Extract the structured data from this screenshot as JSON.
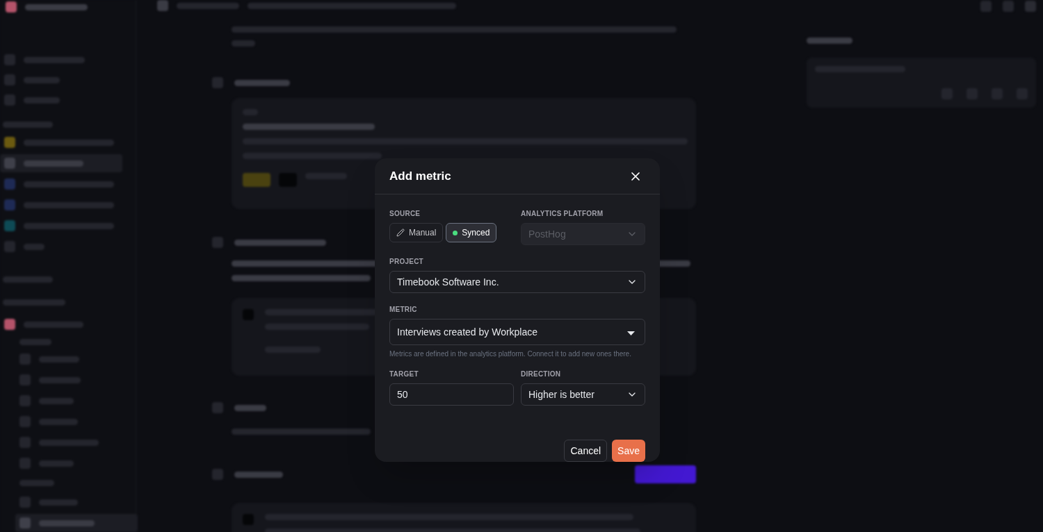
{
  "modal": {
    "title": "Add metric",
    "source_label": "SOURCE",
    "sources": [
      {
        "label": "Manual",
        "kind": "pencil",
        "selected": false
      },
      {
        "label": "Synced",
        "kind": "dot",
        "selected": true
      }
    ],
    "platform_label": "ANALYTICS PLATFORM",
    "platform": {
      "value": "PostHog",
      "disabled": true
    },
    "project_label": "PROJECT",
    "project": "Timebook Software Inc.",
    "metric_label": "METRIC",
    "metric": "Interviews created by Workplace",
    "help": "Metrics are defined in the analytics platform. Connect it to add new ones there.",
    "target_label": "TARGET",
    "target": "50",
    "direction_label": "DIRECTION",
    "direction": "Higher is better",
    "buttons": [
      {
        "label": "Cancel",
        "kind": "secondary"
      },
      {
        "label": "Save",
        "kind": "primary"
      }
    ]
  }
}
